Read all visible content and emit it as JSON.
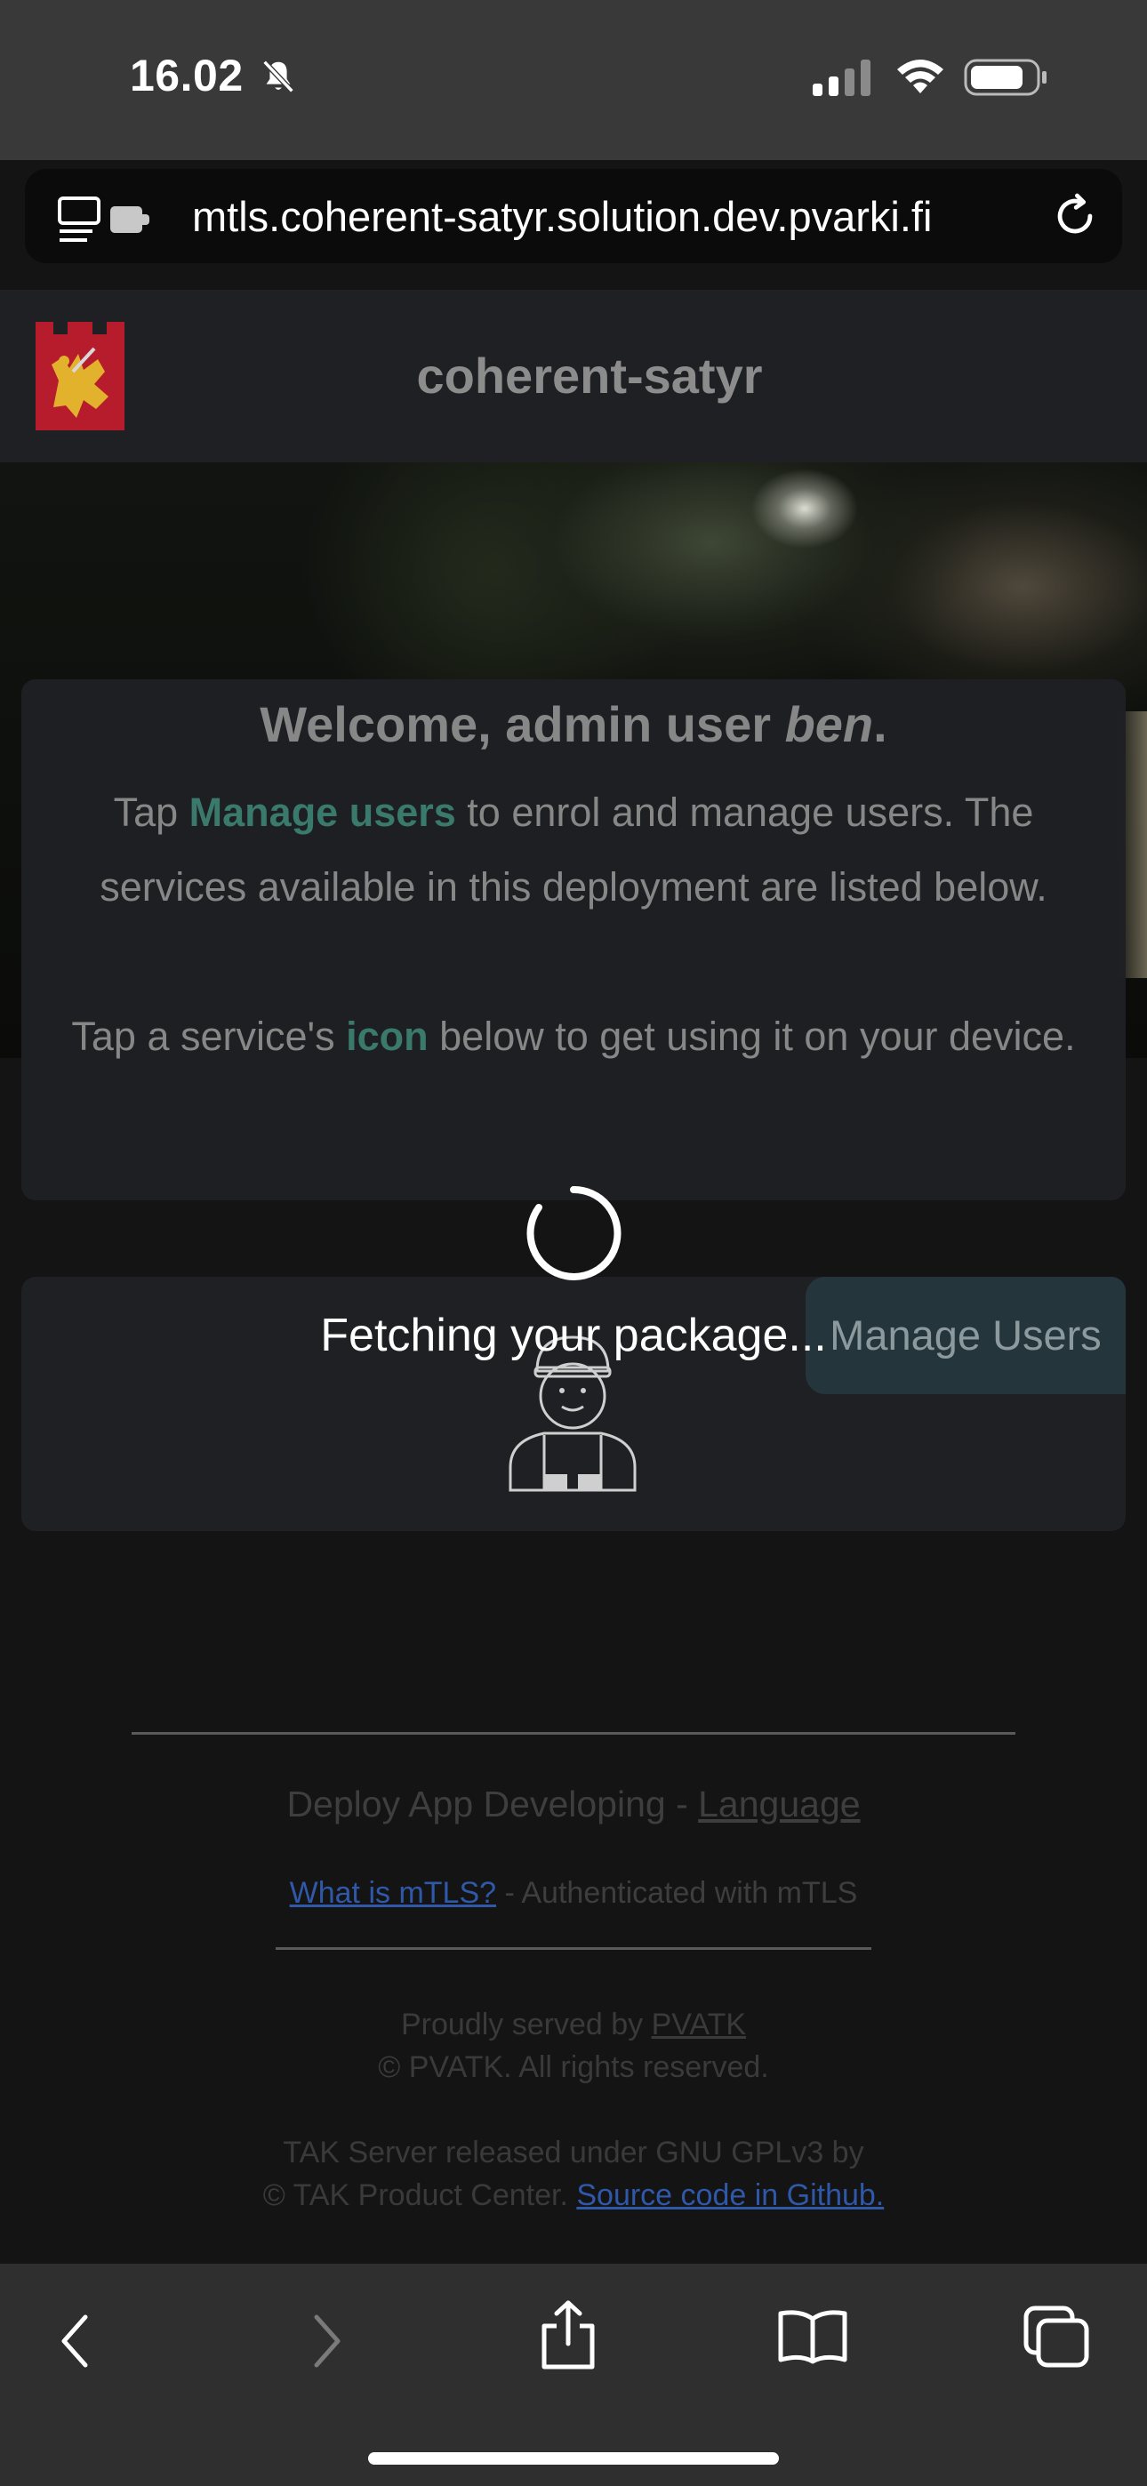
{
  "status_bar": {
    "time": "16.02",
    "icons": [
      "bell-slash-icon",
      "cellular-signal-icon",
      "wifi-icon",
      "battery-icon"
    ]
  },
  "browser": {
    "url": "mtls.coherent-satyr.solution.dev.pvarki.fi",
    "icons": [
      "tab-extension-icon",
      "reload-icon"
    ]
  },
  "header": {
    "title": "coherent-satyr",
    "logo": "lion-crest-logo"
  },
  "welcome": {
    "title_prefix": "Welcome, admin user ",
    "title_user": "ben",
    "title_suffix": ".",
    "p1_before": "Tap ",
    "p1_link": "Manage users",
    "p1_after": " to enrol and manage users. The services available in this deployment are listed below.",
    "p2_before": "Tap a service's ",
    "p2_link": "icon",
    "p2_after": " below to get using it on your device."
  },
  "users": {
    "manage_button": "Manage Users",
    "icon": "user-worker-icon"
  },
  "loading": {
    "text": "Fetching your package..."
  },
  "footer": {
    "line1_text": "Deploy App Developing - ",
    "line1_link": "Language",
    "line2_link": "What is mTLS?",
    "line2_text": " - Authenticated with mTLS",
    "line3_text": "Proudly served by ",
    "line3_link": "PVATK",
    "line4_text": "© PVATK. All rights reserved.",
    "line5_text": "TAK Server released under GNU GPLv3 by",
    "line6_text": "© TAK Product Center. ",
    "line6_link": "Source code in Github."
  },
  "toolbar": {
    "icons": [
      "back-icon",
      "forward-icon",
      "share-icon",
      "bookmarks-icon",
      "tabs-icon"
    ]
  },
  "colors": {
    "accent_green": "#3a7d6e",
    "link_blue": "#2f58a8",
    "card_bg": "#1f2023",
    "button_bg": "#25353c"
  }
}
